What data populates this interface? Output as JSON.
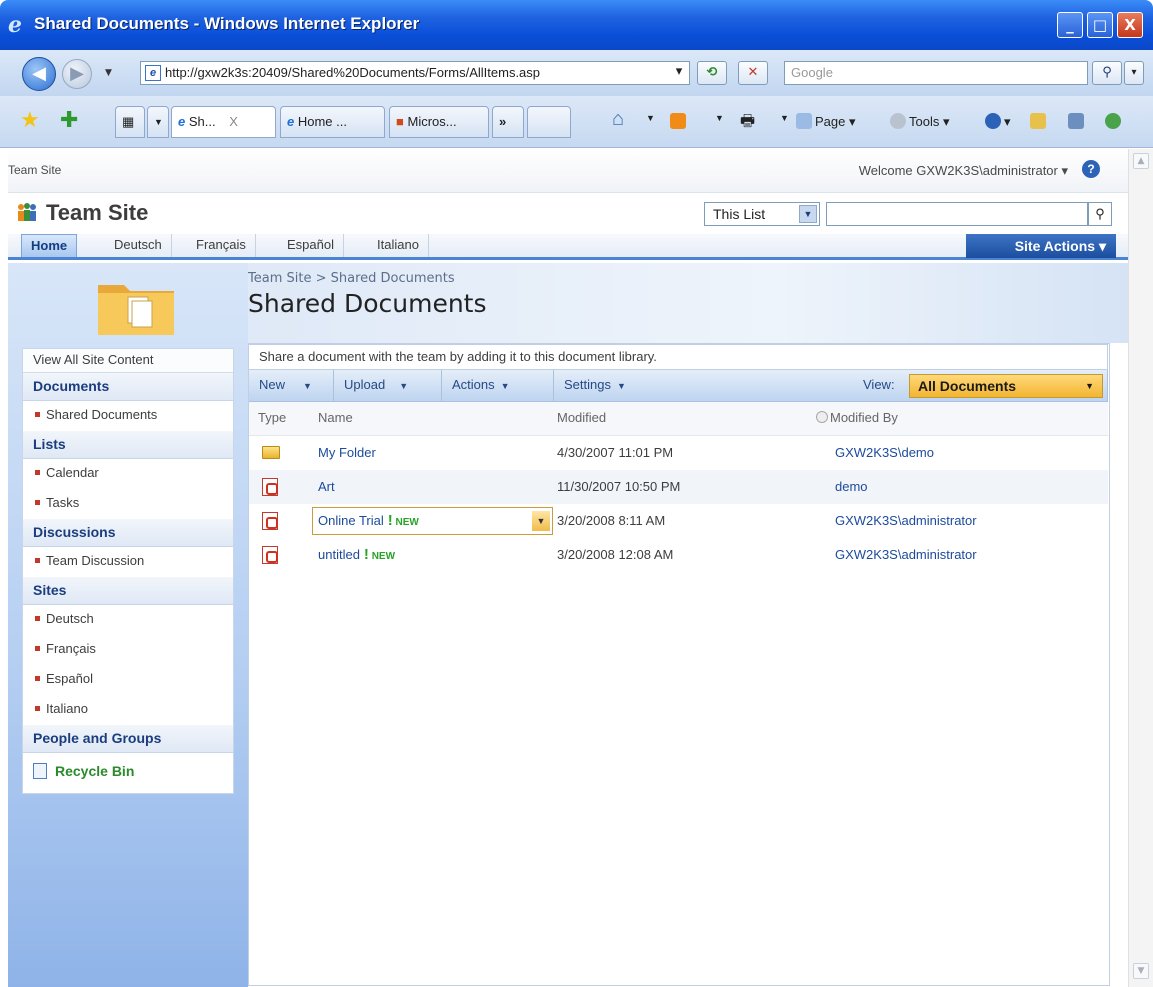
{
  "window": {
    "title": "Shared Documents - Windows Internet Explorer",
    "min_label": "_",
    "max_label": "□",
    "close_label": "X"
  },
  "browser": {
    "address": "http://gxw2k3s:20409/Shared%20Documents/Forms/AllItems.asp",
    "search_placeholder": "Google",
    "tabs": [
      {
        "label": "Sh...",
        "active": true
      },
      {
        "label": "Home ...",
        "active": false
      },
      {
        "label": "Micros...",
        "active": false
      }
    ],
    "tab_overflow": "»",
    "commands": {
      "page": "Page",
      "tools": "Tools"
    }
  },
  "sharepoint": {
    "global_breadcrumb": "Team Site",
    "welcome": "Welcome GXW2K3S\\administrator ▾",
    "site_title": "Team Site",
    "search_scope": "This List",
    "top_nav": [
      {
        "label": "Home",
        "active": true
      },
      {
        "label": "Deutsch",
        "active": false
      },
      {
        "label": "Français",
        "active": false
      },
      {
        "label": "Español",
        "active": false
      },
      {
        "label": "Italiano",
        "active": false
      }
    ],
    "site_actions": "Site Actions ▾"
  },
  "left_nav": {
    "view_all": "View All Site Content",
    "documents_heading": "Documents",
    "documents_items": [
      "Shared Documents"
    ],
    "lists_heading": "Lists",
    "lists_items": [
      "Calendar",
      "Tasks"
    ],
    "discussions_heading": "Discussions",
    "discussions_items": [
      "Team Discussion"
    ],
    "sites_heading": "Sites",
    "sites_items": [
      "Deutsch",
      "Français",
      "Español",
      "Italiano"
    ],
    "people_heading": "People and Groups",
    "recycle_bin": "Recycle Bin"
  },
  "main": {
    "breadcrumb": "Team Site > Shared Documents",
    "page_title": "Shared Documents",
    "description": "Share a document with the team by adding it to this document library.",
    "toolbar": {
      "new": "New",
      "upload": "Upload",
      "actions": "Actions",
      "settings": "Settings",
      "view_label": "View:",
      "view_value": "All Documents"
    },
    "columns": {
      "type": "Type",
      "name": "Name",
      "modified": "Modified",
      "modified_by": "Modified By"
    },
    "new_badge": "NEW",
    "rows": [
      {
        "type": "folder",
        "name": "My Folder",
        "modified": "4/30/2007 11:01 PM",
        "modified_by": "GXW2K3S\\demo",
        "is_new": false
      },
      {
        "type": "pdf",
        "name": "Art",
        "modified": "11/30/2007 10:50 PM",
        "modified_by": "demo",
        "is_new": false
      },
      {
        "type": "pdf",
        "name": "Online Trial",
        "modified": "3/20/2008 8:11 AM",
        "modified_by": "GXW2K3S\\administrator",
        "is_new": true
      },
      {
        "type": "pdf",
        "name": "untitled",
        "modified": "3/20/2008 12:08 AM",
        "modified_by": "GXW2K3S\\administrator",
        "is_new": true
      }
    ]
  },
  "colors": {
    "link": "#1c4b9c",
    "accent": "#4c84d3",
    "new_badge": "#27a327",
    "view_selector": "#f3b531"
  }
}
